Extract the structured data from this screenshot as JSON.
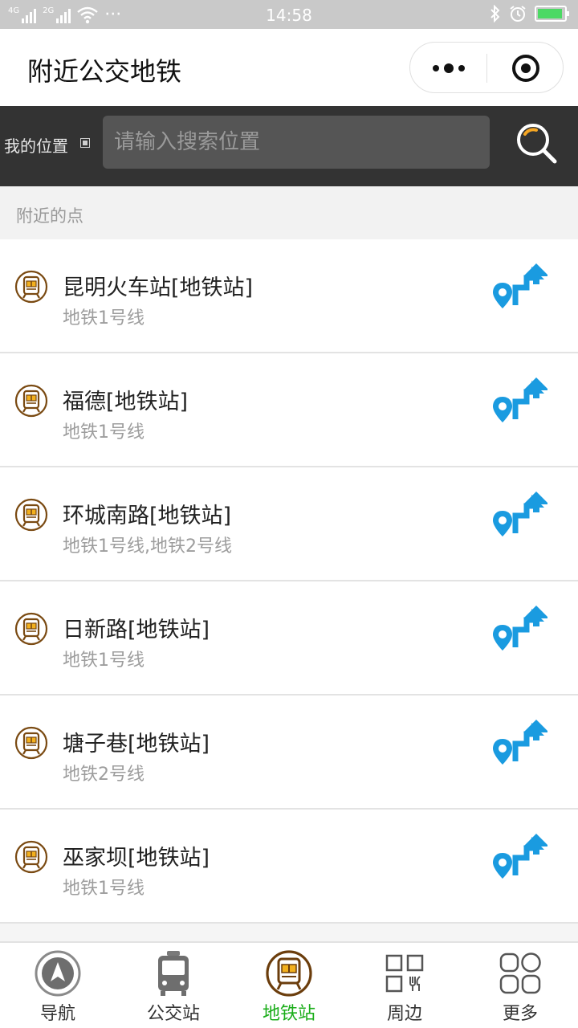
{
  "status_bar": {
    "time": "14:58",
    "sim1": "4G",
    "sim2": "2G",
    "dots": "···"
  },
  "header": {
    "title": "附近公交地铁"
  },
  "search": {
    "location_label": "我的位置",
    "placeholder": "请输入搜索位置"
  },
  "section": {
    "title": "附近的点"
  },
  "stations": [
    {
      "name": "昆明火车站[地铁站]",
      "lines": "地铁1号线"
    },
    {
      "name": "福德[地铁站]",
      "lines": "地铁1号线"
    },
    {
      "name": "环城南路[地铁站]",
      "lines": "地铁1号线,地铁2号线"
    },
    {
      "name": "日新路[地铁站]",
      "lines": "地铁1号线"
    },
    {
      "name": "塘子巷[地铁站]",
      "lines": "地铁2号线"
    },
    {
      "name": "巫家坝[地铁站]",
      "lines": "地铁1号线"
    }
  ],
  "tabs": [
    {
      "label": "导航",
      "icon": "navigation-icon",
      "active": false
    },
    {
      "label": "公交站",
      "icon": "bus-icon",
      "active": false
    },
    {
      "label": "地铁站",
      "icon": "metro-icon",
      "active": true
    },
    {
      "label": "周边",
      "icon": "nearby-icon",
      "active": false
    },
    {
      "label": "更多",
      "icon": "more-icon",
      "active": false
    }
  ],
  "colors": {
    "accent_green": "#1aad19",
    "route_blue": "#1a9be0",
    "metro_brown": "#7a4a12",
    "search_bar_bg": "#333333"
  }
}
